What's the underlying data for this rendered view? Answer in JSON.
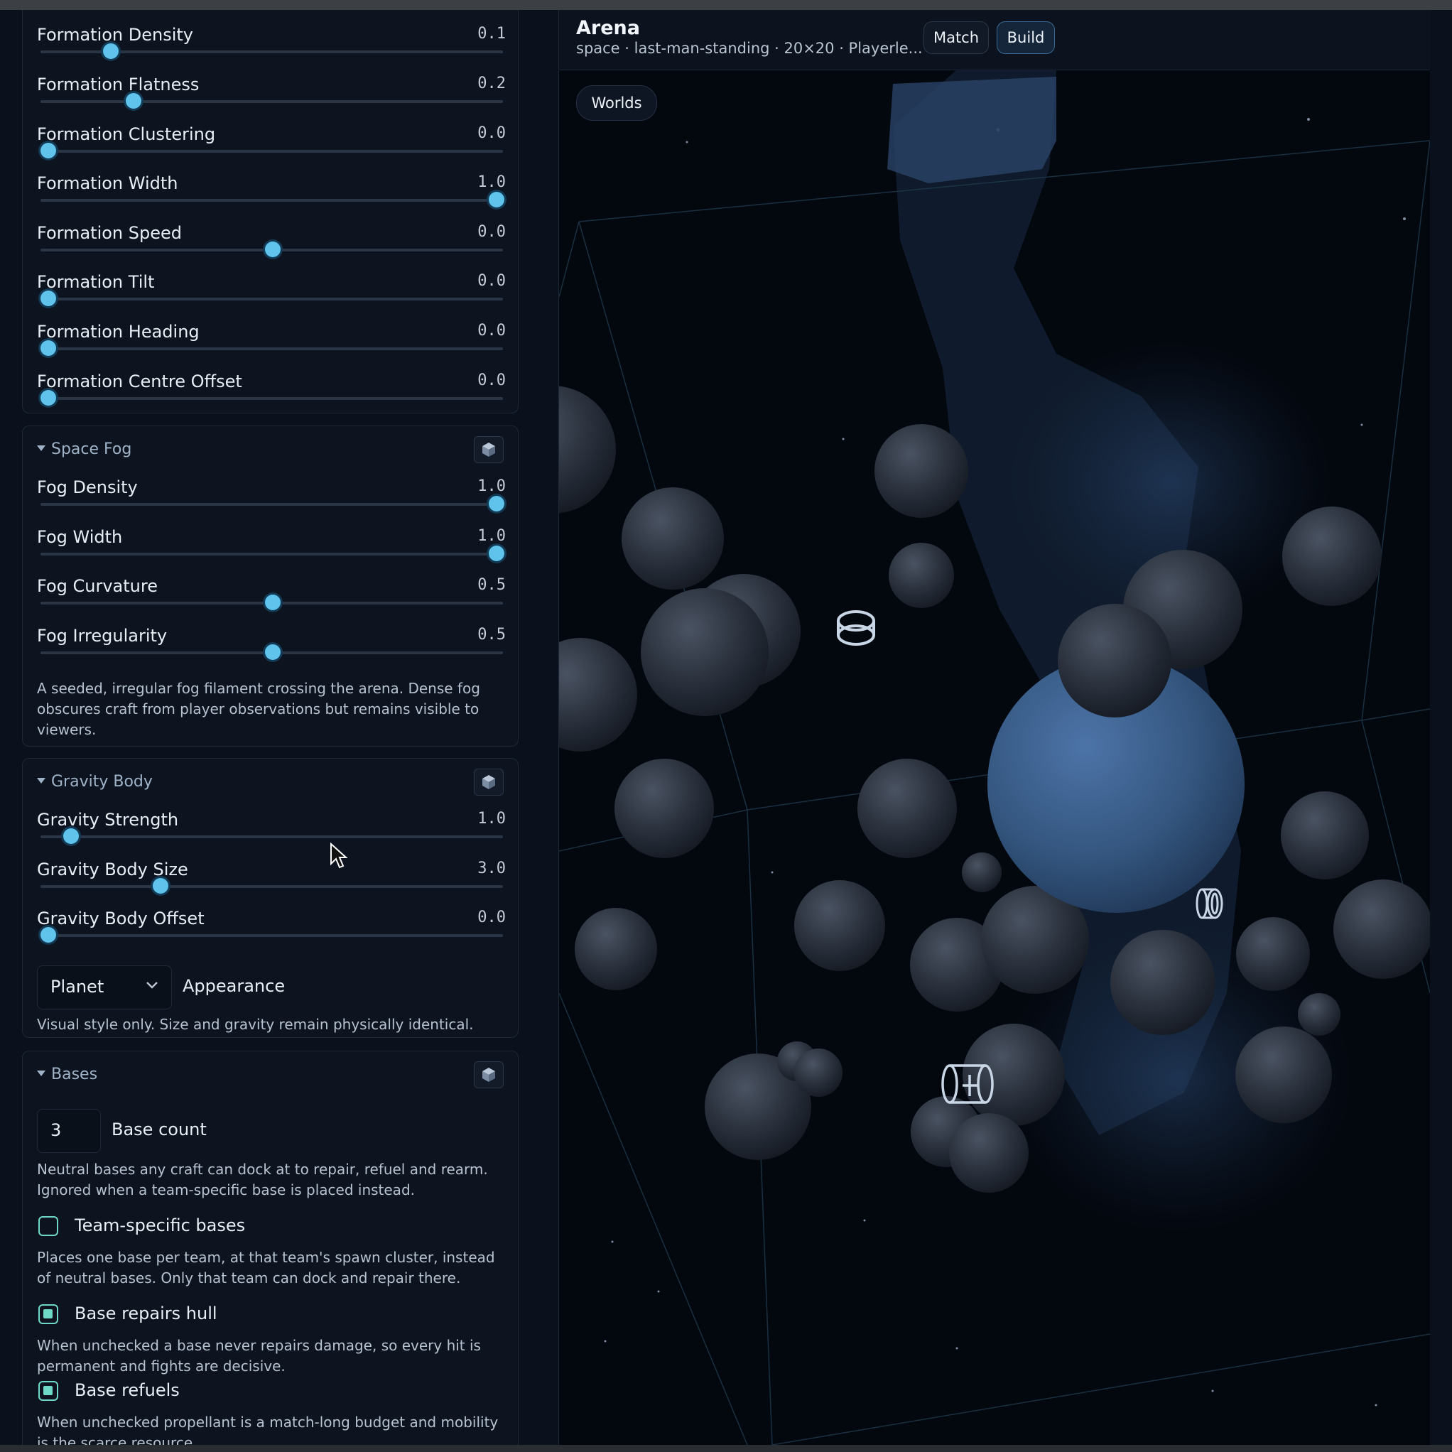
{
  "formation": {
    "sliders": [
      {
        "label": "Formation Density",
        "value": "0.1",
        "fraction": 0.14
      },
      {
        "label": "Formation Flatness",
        "value": "0.2",
        "fraction": 0.19
      },
      {
        "label": "Formation Clustering",
        "value": "0.0",
        "fraction": 0.0
      },
      {
        "label": "Formation Width",
        "value": "1.0",
        "fraction": 1.0
      },
      {
        "label": "Formation Speed",
        "value": "0.0",
        "fraction": 0.5
      },
      {
        "label": "Formation Tilt",
        "value": "0.0",
        "fraction": 0.0
      },
      {
        "label": "Formation Heading",
        "value": "0.0",
        "fraction": 0.0
      },
      {
        "label": "Formation Centre Offset",
        "value": "0.0",
        "fraction": 0.0
      }
    ]
  },
  "space_fog": {
    "title": "Space Fog",
    "sliders": [
      {
        "label": "Fog Density",
        "value": "1.0",
        "fraction": 1.0
      },
      {
        "label": "Fog Width",
        "value": "1.0",
        "fraction": 1.0
      },
      {
        "label": "Fog Curvature",
        "value": "0.5",
        "fraction": 0.5
      },
      {
        "label": "Fog Irregularity",
        "value": "0.5",
        "fraction": 0.5
      }
    ],
    "description": "A seeded, irregular fog filament crossing the arena. Dense fog obscures craft from player observations but remains visible to viewers."
  },
  "gravity_body": {
    "title": "Gravity Body",
    "sliders": [
      {
        "label": "Gravity Strength",
        "value": "1.0",
        "fraction": 0.05
      },
      {
        "label": "Gravity Body Size",
        "value": "3.0",
        "fraction": 0.25
      },
      {
        "label": "Gravity Body Offset",
        "value": "0.0",
        "fraction": 0.0
      }
    ],
    "appearance_value": "Planet",
    "appearance_label": "Appearance",
    "description": "Visual style only. Size and gravity remain physically identical."
  },
  "bases": {
    "title": "Bases",
    "count_value": "3",
    "count_label": "Base count",
    "count_description": "Neutral bases any craft can dock at to repair, refuel and rearm. Ignored when a team-specific base is placed instead.",
    "team_specific": {
      "label": "Team-specific bases",
      "checked": false,
      "description": "Places one base per team, at that team's spawn cluster, instead of neutral bases. Only that team can dock and repair there."
    },
    "repairs_hull": {
      "label": "Base repairs hull",
      "checked": true,
      "description": "When unchecked a base never repairs damage, so every hit is permanent and fights are decisive."
    },
    "refuels": {
      "label": "Base refuels",
      "checked": true,
      "description": "When unchecked propellant is a match-long budget and mobility is the scarce resource."
    }
  },
  "arena": {
    "title": "Arena",
    "subtitle": "space · last-man-standing · 20×20 · Playerle...",
    "match_label": "Match",
    "build_label": "Build",
    "worlds_label": "Worlds"
  },
  "colors": {
    "accent": "#5fc3ec",
    "checkbox": "#6fd9c7",
    "background": "#0b111c"
  },
  "icons": [
    "cube-icon",
    "caret-down-icon",
    "chevron-down-icon",
    "mouse-cursor-icon"
  ]
}
